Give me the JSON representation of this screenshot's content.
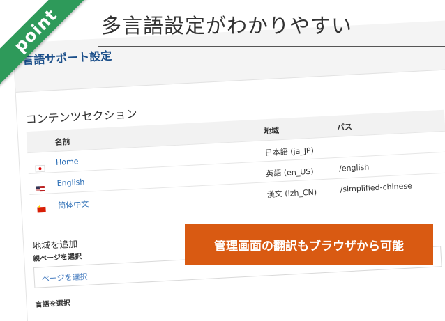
{
  "badge": {
    "text": "point"
  },
  "headline": "多言語設定がわかりやすい",
  "panel": {
    "title": "言語サポート設定",
    "section_title": "コンテンツセクション",
    "table": {
      "headers": {
        "name": "名前",
        "region": "地域",
        "path": "パス"
      },
      "rows": [
        {
          "flag": "jp-flag-icon",
          "name": "Home",
          "region": "日本語 (ja_JP)",
          "path": ""
        },
        {
          "flag": "us-flag-icon",
          "name": "English",
          "region": "英語 (en_US)",
          "path": "/english"
        },
        {
          "flag": "cn-flag-icon",
          "name": "简体中文",
          "region": "漢文 (lzh_CN)",
          "path": "/simplified-chinese"
        }
      ]
    },
    "add_region": "地域を追加",
    "parent_page_label": "親ページを選択",
    "page_select_placeholder": "ページを選択",
    "language_label": "言語を選択"
  },
  "callout": "管理画面の翻訳もブラウザから可能",
  "colors": {
    "ribbon": "#2e9a5a",
    "callout": "#d95a12",
    "link": "#2a6db5",
    "title": "#1b4f8a"
  }
}
